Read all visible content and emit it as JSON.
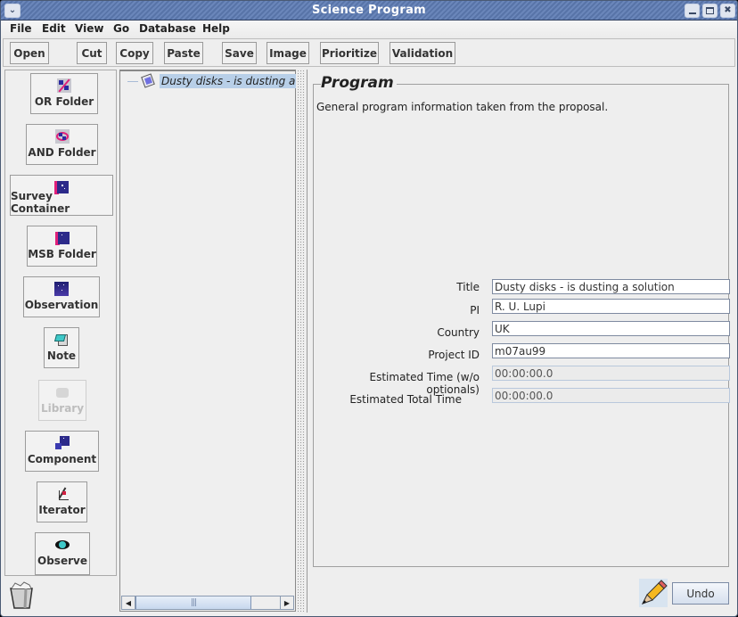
{
  "window": {
    "title": "Science Program",
    "controls": {
      "menu": "window-menu",
      "minimize": "minimize",
      "maximize": "maximize",
      "close": "close"
    }
  },
  "menubar": {
    "items": [
      "File",
      "Edit",
      "View",
      "Go",
      "Database",
      "Help"
    ]
  },
  "toolbar": {
    "buttons": [
      "Open",
      "Cut",
      "Copy",
      "Paste",
      "Save",
      "Image",
      "Prioritize",
      "Validation"
    ]
  },
  "palette": {
    "items": [
      {
        "label": "OR Folder",
        "icon": "or-folder-icon",
        "enabled": true
      },
      {
        "label": "AND Folder",
        "icon": "and-folder-icon",
        "enabled": true
      },
      {
        "label": "Survey Container",
        "icon": "survey-container-icon",
        "enabled": true
      },
      {
        "label": "MSB Folder",
        "icon": "msb-folder-icon",
        "enabled": true
      },
      {
        "label": "Observation",
        "icon": "observation-icon",
        "enabled": true
      },
      {
        "label": "Note",
        "icon": "note-icon",
        "enabled": true
      },
      {
        "label": "Library",
        "icon": "library-icon",
        "enabled": false
      },
      {
        "label": "Component",
        "icon": "component-icon",
        "enabled": true
      },
      {
        "label": "Iterator",
        "icon": "iterator-icon",
        "enabled": true
      },
      {
        "label": "Observe",
        "icon": "observe-eye-icon",
        "enabled": true
      }
    ],
    "trash_icon": "trash-icon"
  },
  "tree": {
    "root_label": "Dusty disks - is dusting a",
    "root_icon": "program-icon",
    "selected": true
  },
  "editor": {
    "group_title": "Program",
    "description": "General program information taken from the proposal.",
    "fields": [
      {
        "label": "Title",
        "value": "Dusty disks - is dusting a solution",
        "editable": true
      },
      {
        "label": "PI",
        "value": "R. U. Lupi",
        "editable": true
      },
      {
        "label": "Country",
        "value": "UK",
        "editable": true
      },
      {
        "label": "Project ID",
        "value": "m07au99",
        "editable": true
      },
      {
        "label": "Estimated Time (w/o optionals)",
        "value": "00:00:00.0",
        "editable": false
      },
      {
        "label": "Estimated Total Time",
        "value": "00:00:00.0",
        "editable": false
      }
    ],
    "undo_label": "Undo",
    "pencil_icon": "pencil-icon"
  }
}
